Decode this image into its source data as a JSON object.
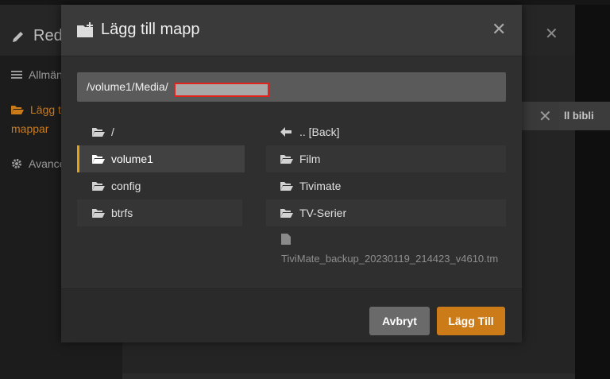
{
  "background": {
    "header_title": "Red",
    "sidebar": [
      {
        "label": "Allmän",
        "icon": "list-icon"
      },
      {
        "label": "Lägg ti",
        "label2": "mappar",
        "icon": "folder-open-icon",
        "active": true
      },
      {
        "label": "Avance",
        "icon": "gear-icon"
      }
    ],
    "library_button": "ll bibli"
  },
  "modal": {
    "title": "Lägg till mapp",
    "path": "/volume1/Media/",
    "directories": [
      {
        "label": "/"
      },
      {
        "label": "volume1",
        "selected": true
      },
      {
        "label": "config"
      },
      {
        "label": "btrfs"
      }
    ],
    "entries": [
      {
        "label": ".. [Back]",
        "icon": "arrow-left-icon"
      },
      {
        "label": "Film",
        "icon": "folder-icon"
      },
      {
        "label": "Tivimate",
        "icon": "folder-icon"
      },
      {
        "label": "TV-Serier",
        "icon": "folder-icon"
      }
    ],
    "file": {
      "label": "TiviMate_backup_20230119_214423_v4610.tm",
      "icon": "file-icon"
    },
    "cancel_label": "Avbryt",
    "add_label": "Lägg Till"
  },
  "colors": {
    "accent": "#cc7b19",
    "selected_bar": "#e5a00d",
    "redaction_border": "#e0231d"
  }
}
